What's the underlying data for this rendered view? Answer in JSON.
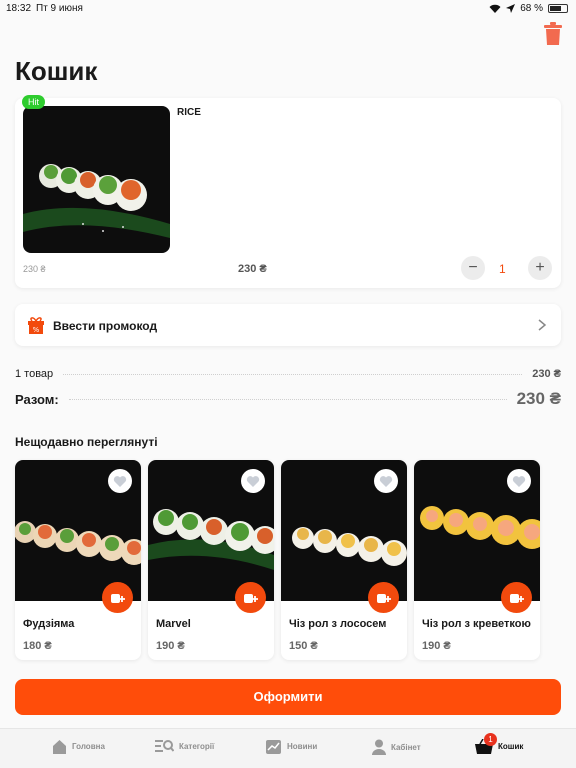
{
  "status_bar": {
    "time": "18:32",
    "date": "Пт 9 июня",
    "battery": "68 %"
  },
  "page": {
    "title": "Кошик"
  },
  "cart_item": {
    "badge": "Hit",
    "name": "RICE",
    "old_price": "230 ₴",
    "price": "230 ₴",
    "quantity": "1",
    "minus": "−",
    "plus": "+"
  },
  "promo": {
    "label": "Ввести промокод"
  },
  "summary": {
    "items_label": "1 товар",
    "items_value": "230 ₴",
    "total_label": "Разом:",
    "total_value": "230 ₴"
  },
  "recent": {
    "title": "Нещодавно переглянуті",
    "products": [
      {
        "name": "Фудзіяма",
        "price": "180 ₴"
      },
      {
        "name": "Marvel",
        "price": "190 ₴"
      },
      {
        "name": "Чіз рол з лососем",
        "price": "150 ₴"
      },
      {
        "name": "Чіз рол з креветкою",
        "price": "190 ₴"
      }
    ]
  },
  "checkout": {
    "label": "Оформити"
  },
  "tabbar": {
    "home": "Головна",
    "categories": "Категорії",
    "news": "Новини",
    "account": "Кабінет",
    "cart": "Кошик",
    "cart_badge": "1"
  },
  "colors": {
    "accent": "#ff4d0a",
    "hit_badge": "#2ecc2e",
    "background": "#fafafa"
  }
}
